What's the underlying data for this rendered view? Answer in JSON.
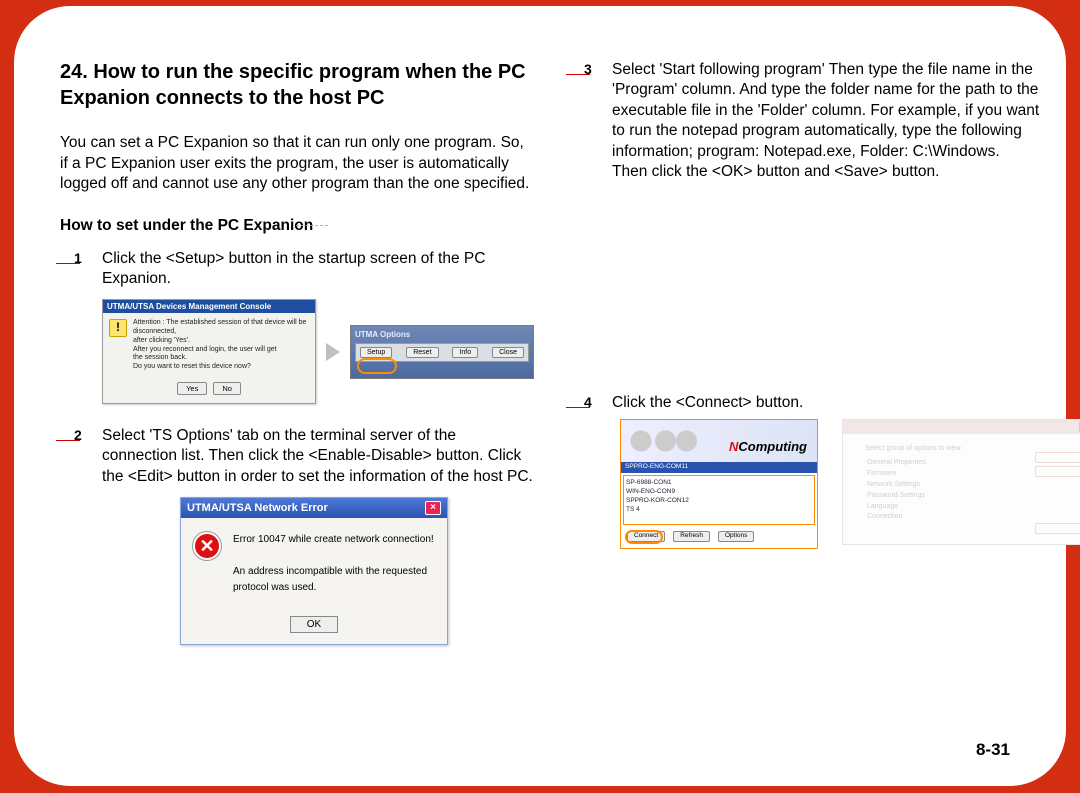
{
  "section_title": "24. How to run the specific program when the PC Expanion connects to the host PC",
  "intro": "You can set a PC Expanion so that it can run only one program. So, if a PC Expanion user exits the program, the user is automatically logged off and cannot use any other program than the one specified.",
  "subhead": "How to set under the PC Expanion",
  "steps": {
    "s1": "Click the <Setup> button in the startup screen of the PC Expanion.",
    "s2": "Select 'TS Options' tab on the terminal server of the connection list. Then click the <Enable-Disable> button. Click the <Edit> button in order to set the information of the host PC.",
    "s3": "Select 'Start following program' Then type the file name in the 'Program' column. And type the folder name for the path to the executable file in the 'Folder' column. For example, if you want to run the notepad program automatically, type the following information; program: Notepad.exe, Folder: C:\\Windows.\nThen click the <OK> button and <Save> button.",
    "s4": "Click the <Connect> button."
  },
  "dlg1": {
    "title": "UTMA/UTSA Devices Management Console",
    "line1": "Attention : The established session of that device will be disconnected,",
    "line2": "after clicking 'Yes'.",
    "line3": "After you reconnect and login, the user will get",
    "line4": "the session back.",
    "line5": "Do you want to reset this device now?",
    "yes": "Yes",
    "no": "No"
  },
  "photo": {
    "caption": "UTMA Options",
    "b1": "Setup",
    "b2": "Reset",
    "b3": "Info",
    "b4": "Close"
  },
  "err": {
    "title": "UTMA/UTSA Network  Error",
    "line1": "Error 10047 while create network connection!",
    "line2": "An address incompatible with the requested protocol was used.",
    "ok": "OK"
  },
  "s4left": {
    "brand_pre": "N",
    "brand_rest": "Computing",
    "hdr": "SPPRO-ENG-COM11",
    "r1": "SP-6988-CON1",
    "r2": "WIN-ENG-CON9",
    "r3": "SPPRO-KOR-CON12",
    "r4": "TS 4",
    "b1": "Connect",
    "b2": "Refresh",
    "b3": "Options"
  },
  "s4right": {
    "hint": "Select group of options to view:",
    "m1": "General Properties",
    "m2": "Firmware",
    "m3": "Network Settings",
    "m4": "Password Settings",
    "m5": "Language",
    "m6": "Connection"
  },
  "page_number": "8-31"
}
